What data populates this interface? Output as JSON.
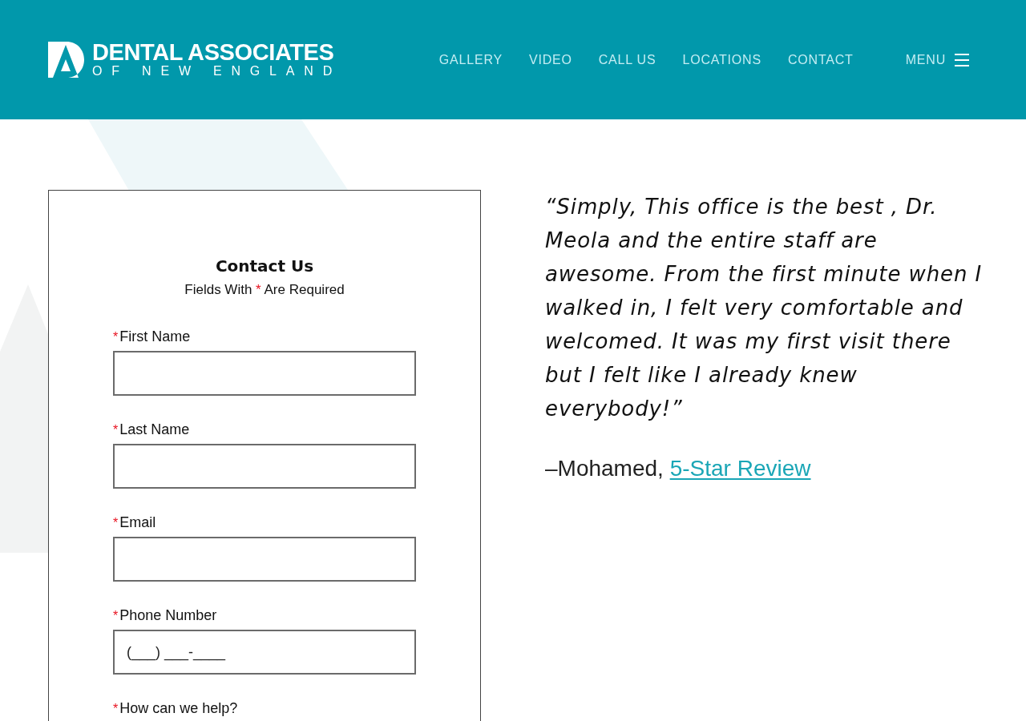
{
  "header": {
    "logo": {
      "line_1": "DENTAL ASSOCIATES",
      "line_2": "OF NEW ENGLAND"
    },
    "nav": [
      "GALLERY",
      "VIDEO",
      "CALL US",
      "LOCATIONS",
      "CONTACT"
    ],
    "menu_button": {
      "label": "MENU"
    }
  },
  "form": {
    "title": "Contact Us",
    "subtitle": {
      "before": "Fields With",
      "mark": "*",
      "after": "Are Required"
    },
    "fields": [
      {
        "kind": "input",
        "required_mark": "*",
        "label": "First Name"
      },
      {
        "kind": "input",
        "required_mark": "*",
        "label": "Last Name"
      },
      {
        "kind": "input",
        "required_mark": "*",
        "label": "Email"
      },
      {
        "kind": "input",
        "required_mark": "*",
        "label": "Phone Number",
        "placeholder": "(___) ___-____"
      },
      {
        "kind": "label",
        "required_mark": "*",
        "label": "How can we help?"
      }
    ]
  },
  "testimonial": {
    "quote": "“Simply, This office is the best , Dr. Meola and the entire staff are awesome. From the first minute when I walked in, I felt very comfortable and welcomed. It was my first visit there but I felt like I already knew everybody!”",
    "author": "–Mohamed,",
    "link": "5-Star Review"
  }
}
